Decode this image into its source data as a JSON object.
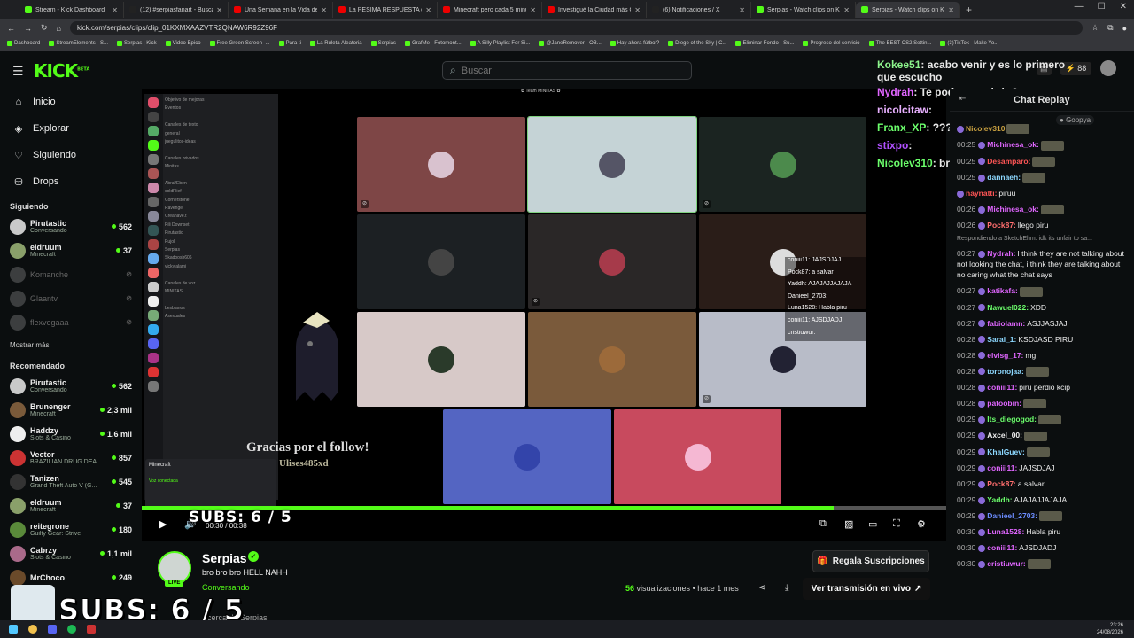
{
  "browser": {
    "tabs": [
      {
        "label": "Stream - Kick Dashboard",
        "fav": "#53fc18"
      },
      {
        "label": "(12) #serpiasfanart - Buscar / X",
        "fav": "#222"
      },
      {
        "label": "Una Semana en la Vida de M...",
        "fav": "#e00"
      },
      {
        "label": "La PÉSIMA RESPUESTA de JWU...",
        "fav": "#e00"
      },
      {
        "label": "Minecraft pero cada 5 minutos...",
        "fav": "#e00"
      },
      {
        "label": "Investigué la Ciudad más Obes...",
        "fav": "#e00"
      },
      {
        "label": "(6) Notificaciones / X",
        "fav": "#222"
      },
      {
        "label": "Serpias - Watch clips on Kick",
        "fav": "#53fc18"
      },
      {
        "label": "Serpias - Watch clips on Kick",
        "fav": "#53fc18"
      }
    ],
    "new_tab": "+",
    "url": "kick.com/serpias/clips/clip_01KXMXAAZVTR2QNAW6R92Z96F",
    "bookmarks": [
      "Dashboard",
      "StreamElements - S...",
      "Serpias | Kick",
      "Video Epico",
      "Free Green Screen -...",
      "Para ti",
      "La Ruleta Aleatoria",
      "Serpias",
      "GrafMe - Fotomont...",
      "A Silly Playlist For Si...",
      "@JaneRemover - OB...",
      "Hay ahora fútbol?",
      "Diege of the Sky | C...",
      "Eliminar Fondo - Su...",
      "Progreso del servicio",
      "The BEST CS2 Settin...",
      "(3)TikTok - Make Yo..."
    ]
  },
  "header": {
    "logo": "KICK",
    "logo_sup": "BETA",
    "search_placeholder": "Buscar",
    "notif_count": "88"
  },
  "sidebar": {
    "nav": [
      {
        "label": "Inicio",
        "icon": "home-icon",
        "glyph": "⌂"
      },
      {
        "label": "Explorar",
        "icon": "compass-icon",
        "glyph": "◈"
      },
      {
        "label": "Siguiendo",
        "icon": "heart-icon",
        "glyph": "♡"
      },
      {
        "label": "Drops",
        "icon": "gift-icon",
        "glyph": "⛁"
      }
    ],
    "following_title": "Siguiendo",
    "following": [
      {
        "name": "Pirutastic",
        "cat": "Conversando",
        "viewers": "562",
        "live": true,
        "color": "#c9c9c9"
      },
      {
        "name": "eldruum",
        "cat": "Minecraft",
        "viewers": "37",
        "live": true,
        "color": "#8aa06a"
      },
      {
        "name": "Komanche",
        "cat": "",
        "viewers": "",
        "live": false,
        "color": "#888"
      },
      {
        "name": "Glaantv",
        "cat": "",
        "viewers": "",
        "live": false,
        "color": "#888"
      },
      {
        "name": "flexvegaaa",
        "cat": "",
        "viewers": "",
        "live": false,
        "color": "#888"
      }
    ],
    "show_more": "Mostrar más",
    "recommended_title": "Recomendado",
    "recommended": [
      {
        "name": "Pirutastic",
        "cat": "Conversando",
        "viewers": "562",
        "color": "#c9c9c9"
      },
      {
        "name": "Brunenger",
        "cat": "Minecraft",
        "viewers": "2,3 mil",
        "color": "#7a5a3a"
      },
      {
        "name": "Haddzy",
        "cat": "Slots & Casino",
        "viewers": "1,6 mil",
        "color": "#eee"
      },
      {
        "name": "Vector",
        "cat": "BRAZILIAN DRUG DEA...",
        "viewers": "857",
        "color": "#c33"
      },
      {
        "name": "Tanizen",
        "cat": "Grand Theft Auto V (G...",
        "viewers": "545",
        "color": "#333"
      },
      {
        "name": "eldruum",
        "cat": "Minecraft",
        "viewers": "37",
        "color": "#8aa06a"
      },
      {
        "name": "reitegrone",
        "cat": "Guilty Gear: Strive",
        "viewers": "180",
        "color": "#5a8a3a"
      },
      {
        "name": "Cabrzy",
        "cat": "Slots & Casino",
        "viewers": "1,1 mil",
        "color": "#aa6a8a"
      },
      {
        "name": "MrChoco",
        "cat": "",
        "viewers": "249",
        "color": "#6a4a2a"
      }
    ]
  },
  "video": {
    "team_title": "Team MINITAS",
    "discord_channels": [
      "Objetivo de mejoras",
      "Eventos",
      "",
      "Canales de texto",
      "general",
      "juegulitos-ideas",
      "",
      "Canales privados",
      "Minitas",
      "",
      "Abral/Eben",
      "coldFlief",
      "Cornerstone",
      "Ravenge",
      "Creanave.t",
      "Pili Downset",
      "Pirutastic",
      "Pujol",
      "Serpias",
      "Skadoosh606",
      "vickyjalami",
      "",
      "Canales de voz",
      "MINITAS",
      "",
      "Lesbianos",
      "Asexuales"
    ],
    "minecraft_label": "Minecraft",
    "minecraft_status": "Voz conectada",
    "tiles": [
      {
        "bg": "#7e4646",
        "av": "#d9c2cf",
        "muted": true
      },
      {
        "bg": "#c5d3d6",
        "av": "#556",
        "muted": false
      },
      {
        "bg": "#1b2421",
        "av": "#4c8a4c",
        "muted": true
      },
      {
        "bg": "#1c2023",
        "av": "#444",
        "muted": false
      },
      {
        "bg": "#2a2727",
        "av": "#a63a4a",
        "muted": true
      },
      {
        "bg": "#2a1d18",
        "av": "#ddd",
        "muted": false
      },
      {
        "bg": "#d7c9c8",
        "av": "#2a3a2a",
        "muted": false
      },
      {
        "bg": "#7a5a3b",
        "av": "#9c6a3a",
        "muted": false
      },
      {
        "bg": "#b8bcc8",
        "av": "#223",
        "muted": true
      },
      {
        "bg": "#5465c2",
        "av": "#3344aa",
        "muted": false
      },
      {
        "bg": "#c84a5e",
        "av": "#f5b8d3",
        "muted": false
      }
    ],
    "overlay_chat": [
      "coniii11: JAJSDJAJ",
      "Pock87: a salvar",
      "Yaddh: AJAJAJJAJAJA",
      "Danieel_2703:",
      "Luna1528: Habla piru",
      "coniii11: AJSDJADJ",
      "cristiuwur:"
    ],
    "follow_text": "Gracias por el follow!",
    "follow_user": "Ulises485xd",
    "subs_text": "SUBS: 6 / 5",
    "time": "00:30 / 00:38",
    "progress": 0.86,
    "stream_chat": [
      {
        "name": "Kokee51",
        "text": ": acabo venir y es lo primero que escucho",
        "color": "#8df58d"
      },
      {
        "name": "Nydrah",
        "text": ": Te podemos abrir ?",
        "color": "#e066ff"
      },
      {
        "name": "nicolcitaw",
        "text": ":",
        "color": "#e8b0ff"
      },
      {
        "name": "Franx_XP",
        "text": ": ???",
        "color": "#6cff6c"
      },
      {
        "name": "stixpo",
        "text": ":",
        "color": "#b050ff"
      },
      {
        "name": "Nicolev310",
        "text": ": brooo",
        "color": "#6cff6c"
      }
    ]
  },
  "channel": {
    "name": "Serpias",
    "live_badge": "LIVE",
    "title": "bro bro bro HELL NAHH",
    "category": "Conversando",
    "about": "Acerca de Serpias",
    "gift_button": "Regala Suscripciones",
    "views_count": "56",
    "views_suffix": "visualizaciones",
    "time_ago": "• hace 1 mes",
    "watch_button": "Ver transmisión en vivo",
    "subs_overlay": "SUBS: 6 / 5"
  },
  "chat": {
    "title": "Chat Replay",
    "top_user": "Goppya",
    "messages": [
      {
        "t": "",
        "u": "Nicolev310",
        "c": "#c8a040",
        "x": ""
      },
      {
        "t": "00:25",
        "u": "Michinesa_ok:",
        "c": "#e066ff",
        "x": ""
      },
      {
        "t": "00:25",
        "u": "Desamparo:",
        "c": "#ff5555",
        "x": ""
      },
      {
        "t": "00:25",
        "u": "dannaeh:",
        "c": "#8dd8ff",
        "x": ""
      },
      {
        "t": "",
        "u": "naynatti:",
        "c": "#ff5555",
        "x": "piruu"
      },
      {
        "t": "00:26",
        "u": "Michinesa_ok:",
        "c": "#e066ff",
        "x": ""
      },
      {
        "t": "00:26",
        "u": "Pock87:",
        "c": "#ff6e6e",
        "x": "llego piru"
      },
      {
        "t": "",
        "u": "",
        "c": "#999",
        "x": "Respondiendo a SketchEhm: idk its unfair to sa...",
        "reply": true
      },
      {
        "t": "00:27",
        "u": "Nydrah:",
        "c": "#e066ff",
        "x": "I think they are not talking about not looking the chat, i think they are talking about no caring what the chat says"
      },
      {
        "t": "00:27",
        "u": "katikafa:",
        "c": "#e066ff",
        "x": ""
      },
      {
        "t": "00:27",
        "u": "Nawuel022:",
        "c": "#6cff6c",
        "x": "XDD"
      },
      {
        "t": "00:27",
        "u": "fabiolamn:",
        "c": "#e066ff",
        "x": "ASJJASJAJ"
      },
      {
        "t": "00:28",
        "u": "Sarai_1:",
        "c": "#8dd8ff",
        "x": "KSDJASD PIRU"
      },
      {
        "t": "00:28",
        "u": "elvisg_17:",
        "c": "#e066ff",
        "x": "mg"
      },
      {
        "t": "00:28",
        "u": "toronojaa:",
        "c": "#8dd8ff",
        "x": ""
      },
      {
        "t": "00:28",
        "u": "coniii11:",
        "c": "#e066ff",
        "x": "piru perdio kcip"
      },
      {
        "t": "00:28",
        "u": "patoobin:",
        "c": "#e066ff",
        "x": ""
      },
      {
        "t": "00:29",
        "u": "Its_diegogod:",
        "c": "#6cff6c",
        "x": ""
      },
      {
        "t": "00:29",
        "u": "Axcel_00:",
        "c": "#eeeeee",
        "x": ""
      },
      {
        "t": "00:29",
        "u": "KhalGuev:",
        "c": "#8dd8ff",
        "x": ""
      },
      {
        "t": "00:29",
        "u": "coniii11:",
        "c": "#e066ff",
        "x": "JAJSDJAJ"
      },
      {
        "t": "00:29",
        "u": "Pock87:",
        "c": "#ff6e6e",
        "x": "a salvar"
      },
      {
        "t": "00:29",
        "u": "Yaddh:",
        "c": "#6cff6c",
        "x": "AJAJAJJAJAJA"
      },
      {
        "t": "00:29",
        "u": "Danieel_2703:",
        "c": "#6c8dff",
        "x": ""
      },
      {
        "t": "00:30",
        "u": "Luna1528:",
        "c": "#e066ff",
        "x": "Habla piru"
      },
      {
        "t": "00:30",
        "u": "coniii11:",
        "c": "#e066ff",
        "x": "AJSDJADJ"
      },
      {
        "t": "00:30",
        "u": "cristiuwur:",
        "c": "#e066ff",
        "x": ""
      }
    ]
  },
  "clock": {
    "time": "23:26",
    "date": "24/08/2026"
  }
}
